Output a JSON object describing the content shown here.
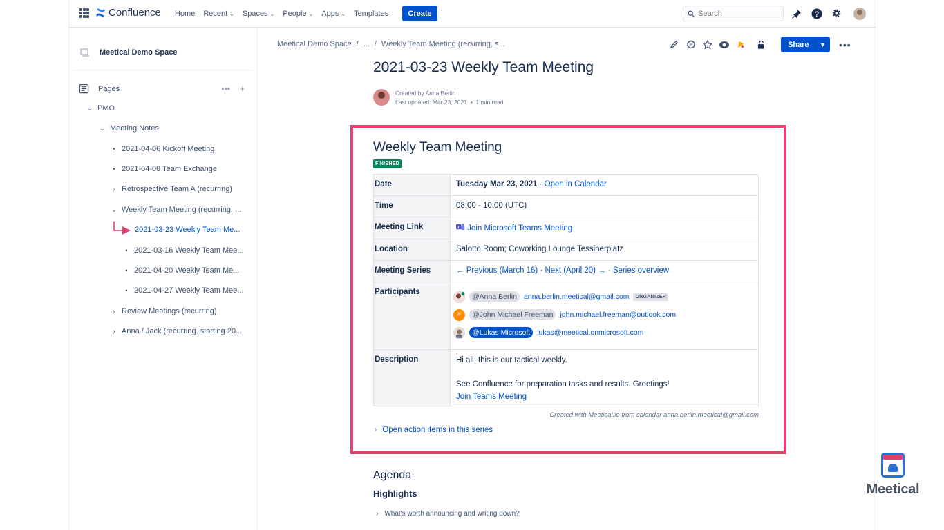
{
  "topnav": {
    "product": "Confluence",
    "links": [
      {
        "label": "Home",
        "chevron": false
      },
      {
        "label": "Recent",
        "chevron": true
      },
      {
        "label": "Spaces",
        "chevron": true
      },
      {
        "label": "People",
        "chevron": true
      },
      {
        "label": "Apps",
        "chevron": true
      },
      {
        "label": "Templates",
        "chevron": false
      }
    ],
    "create_label": "Create",
    "search_placeholder": "Search"
  },
  "sidebar": {
    "space_name": "Meetical Demo Space",
    "pages_label": "Pages",
    "tree": [
      {
        "label": "PMO",
        "kind": "caret-open"
      },
      {
        "label": "Meeting Notes",
        "kind": "caret-open"
      },
      {
        "label": "2021-04-06 Kickoff Meeting",
        "kind": "dot"
      },
      {
        "label": "2021-04-08 Team Exchange",
        "kind": "dot"
      },
      {
        "label": "Retrospective Team A (recurring)",
        "kind": "caret-closed"
      },
      {
        "label": "Weekly Team Meeting (recurring, ...",
        "kind": "caret-open"
      },
      {
        "label": "2021-03-23 Weekly Team Me...",
        "kind": "active"
      },
      {
        "label": "2021-03-16 Weekly Team Mee...",
        "kind": "dot"
      },
      {
        "label": "2021-04-20 Weekly Team Me...",
        "kind": "dot"
      },
      {
        "label": "2021-04-27 Weekly Team Mee...",
        "kind": "dot"
      },
      {
        "label": "Review Meetings (recurring)",
        "kind": "caret-closed"
      },
      {
        "label": "Anna / Jack (recurring, starting 20...",
        "kind": "caret-closed"
      }
    ]
  },
  "breadcrumb": {
    "space": "Meetical Demo Space",
    "sep": "/",
    "ellipsis": "...",
    "parent": "Weekly Team Meeting (recurring, s..."
  },
  "page_actions": {
    "share_label": "Share",
    "more_label": "•••"
  },
  "page": {
    "title": "2021-03-23 Weekly Team Meeting",
    "created_by": "Created by Anna Berlin",
    "last_updated": "Last updated: Mar 23, 2021",
    "read_time": "1 min read"
  },
  "meeting": {
    "title": "Weekly Team Meeting",
    "status": "FINISHED",
    "date_label": "Date",
    "date_value": "Tuesday Mar 23, 2021",
    "date_sep": " · ",
    "open_calendar": "Open in Calendar",
    "time_label": "Time",
    "time_value": "08:00 - 10:00 (UTC)",
    "link_label": "Meeting Link",
    "link_value": "Join Microsoft Teams Meeting",
    "location_label": "Location",
    "location_value": "Salotto Room; Coworking Lounge Tessinerplatz",
    "series_label": "Meeting Series",
    "series_prev": "← Previous (March 16)",
    "series_sep1": " · ",
    "series_next": "Next (April 20) →",
    "series_sep2": " · ",
    "series_overview": "Series overview",
    "participants_label": "Participants",
    "participants": [
      {
        "mention": "@Anna Berlin",
        "email": "anna.berlin.meetical@gmail.com",
        "badge": "ORGANIZER",
        "initials": "",
        "avatar_color": "#c0504d",
        "self": false
      },
      {
        "mention": "@John Michael Freeman",
        "email": "john.michael.freeman@outlook.com",
        "badge": "",
        "initials": "JF",
        "avatar_color": "#ff8b00",
        "self": false
      },
      {
        "mention": "@Lukas Microsoft",
        "email": "lukas@meetical.onmicrosoft.com",
        "badge": "",
        "initials": "",
        "avatar_color": "#b3a397",
        "self": true
      }
    ],
    "description_label": "Description",
    "description_line1": "Hi all, this is our tactical weekly.",
    "description_line2": "See Confluence for preparation tasks and results. Greetings!",
    "description_link": "Join Teams Meeting",
    "created_with": "Created with Meetical.io from calendar anna.berlin.meetical@gmail.com",
    "action_items": "Open action items in this series"
  },
  "agenda": {
    "heading": "Agenda",
    "subheading": "Highlights",
    "expand_item": "What's worth announcing and writing down?"
  },
  "brand": {
    "name": "Meetical"
  },
  "colors": {
    "accent": "#0052cc",
    "highlight_border": "#e2416e",
    "finished_badge": "#00875a"
  }
}
